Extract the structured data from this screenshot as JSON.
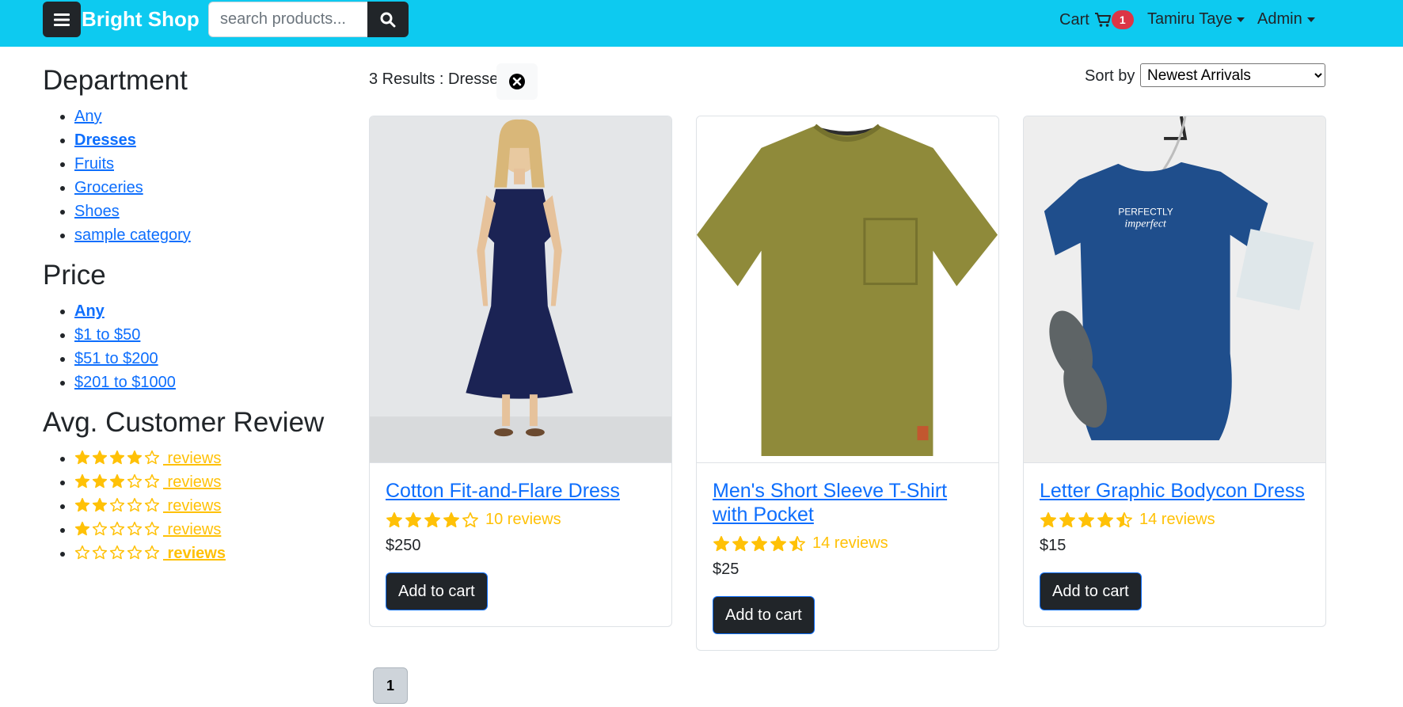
{
  "navbar": {
    "brand": "Bright Shop",
    "search_placeholder": "search products...",
    "cart_label": "Cart",
    "cart_count": "1",
    "user_name": "Tamiru Taye",
    "admin_label": "Admin"
  },
  "sidebar": {
    "department": {
      "title": "Department",
      "items": [
        {
          "label": "Any",
          "active": false
        },
        {
          "label": "Dresses",
          "active": true
        },
        {
          "label": "Fruits",
          "active": false
        },
        {
          "label": "Groceries",
          "active": false
        },
        {
          "label": "Shoes",
          "active": false
        },
        {
          "label": "sample category",
          "active": false
        }
      ]
    },
    "price": {
      "title": "Price",
      "items": [
        {
          "label": "Any",
          "active": true
        },
        {
          "label": "$1 to $50",
          "active": false
        },
        {
          "label": "$51 to $200",
          "active": false
        },
        {
          "label": "$201 to $1000",
          "active": false
        }
      ]
    },
    "review": {
      "title": "Avg. Customer Review",
      "items": [
        {
          "rating": 4,
          "label": " reviews",
          "active": false
        },
        {
          "rating": 3,
          "label": " reviews",
          "active": false
        },
        {
          "rating": 2,
          "label": " reviews",
          "active": false
        },
        {
          "rating": 1,
          "label": " reviews",
          "active": false
        },
        {
          "rating": 0,
          "label": " reviews",
          "active": true
        }
      ]
    }
  },
  "results": {
    "summary": "3 Results : Dresses",
    "sort_label": "Sort by",
    "sort_selected": "Newest Arrivals"
  },
  "products": [
    {
      "name": "Cotton Fit-and-Flare Dress",
      "rating": 4,
      "reviews": "10 reviews",
      "price": "$250",
      "button": "Add to cart",
      "image": "navy-dress-image"
    },
    {
      "name": "Men's Short Sleeve T-Shirt with Pocket",
      "rating": 4.5,
      "reviews": "14 reviews",
      "price": "$25",
      "button": "Add to cart",
      "image": "olive-tshirt-image"
    },
    {
      "name": "Letter Graphic Bodycon Dress",
      "rating": 4.5,
      "reviews": "14 reviews",
      "price": "$15",
      "button": "Add to cart",
      "image": "blue-bodycon-dress-image"
    }
  ],
  "pagination": {
    "current": "1"
  },
  "colors": {
    "navbar": "#0dcaf0",
    "dark": "#212529",
    "link": "#0d6efd",
    "star": "#ffc107",
    "badge": "#dc3545"
  }
}
